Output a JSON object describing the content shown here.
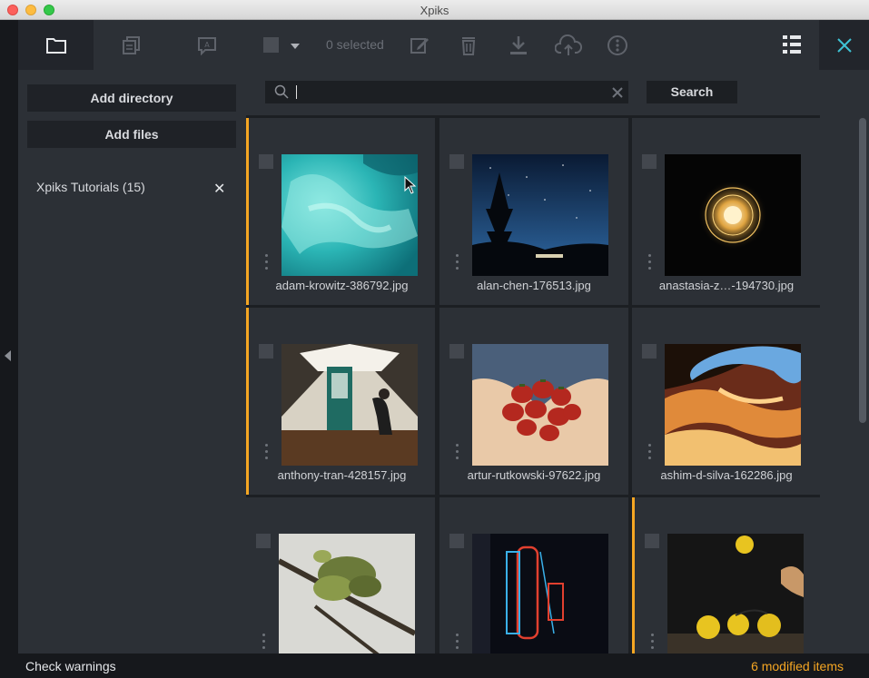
{
  "window": {
    "title": "Xpiks"
  },
  "toolbar": {
    "selection_count": "0 selected",
    "icons": [
      "folder-icon",
      "files-icon",
      "keywords-icon",
      "checkbox-icon",
      "edit-icon",
      "delete-icon",
      "download-icon",
      "upload-icon",
      "more-icon",
      "list-view-icon",
      "close-icon"
    ]
  },
  "sidebar": {
    "add_directory_label": "Add directory",
    "add_files_label": "Add files",
    "directories": [
      {
        "label": "Xpiks Tutorials (15)"
      }
    ]
  },
  "search": {
    "value": "",
    "button_label": "Search"
  },
  "grid": {
    "items": [
      {
        "filename": "adam-krowitz-386792.jpg",
        "modified": true
      },
      {
        "filename": "alan-chen-176513.jpg",
        "modified": false
      },
      {
        "filename": "anastasia-z…-194730.jpg",
        "modified": false
      },
      {
        "filename": "anthony-tran-428157.jpg",
        "modified": true
      },
      {
        "filename": "artur-rutkowski-97622.jpg",
        "modified": false
      },
      {
        "filename": "ashim-d-silva-162286.jpg",
        "modified": false
      },
      {
        "filename": "",
        "modified": false
      },
      {
        "filename": "",
        "modified": false
      },
      {
        "filename": "",
        "modified": true
      }
    ]
  },
  "status": {
    "left_label": "Check warnings",
    "right_label": "6 modified items"
  },
  "colors": {
    "accent_modified": "#f5a623",
    "close_accent": "#3ec3d5"
  }
}
